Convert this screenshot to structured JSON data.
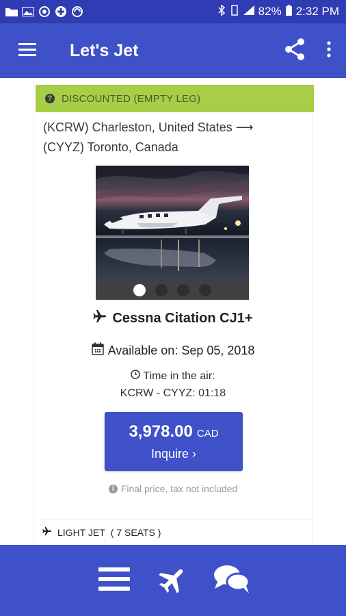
{
  "status_bar": {
    "battery": "82%",
    "time": "2:32 PM",
    "icons": [
      "folder-icon",
      "image-icon",
      "sync-icon",
      "medical-icon",
      "browser-icon",
      "bluetooth-icon",
      "vibrate-icon",
      "signal-icon",
      "battery-icon"
    ]
  },
  "app_bar": {
    "title": "Let's Jet",
    "icons": [
      "hamburger-menu-icon",
      "share-icon",
      "more-vert-icon"
    ]
  },
  "listing": {
    "badge": "DISCOUNTED (EMPTY LEG)",
    "route_line1": "(KCRW) Charleston, United States ⟶",
    "route_line2": "(CYYZ) Toronto, Canada",
    "carousel": {
      "total": 4,
      "active_index": 0
    },
    "aircraft": "Cessna Citation CJ1+",
    "available": "Available on: Sep 05, 2018",
    "time_label": "Time in the air:",
    "time_value": "KCRW - CYYZ: 01:18",
    "price": "3,978.00",
    "currency": "CAD",
    "inquire": "Inquire ›",
    "note": "Final price, tax not included"
  },
  "next_listing": {
    "category": "LIGHT JET",
    "seats": "( 7 SEATS )"
  },
  "bottom_nav": {
    "icons": [
      "list-icon",
      "plane-icon",
      "chat-icon"
    ]
  },
  "colors": {
    "primary": "#3f51c8",
    "status_bar": "#2f3cb3",
    "badge": "#a6ce47"
  }
}
